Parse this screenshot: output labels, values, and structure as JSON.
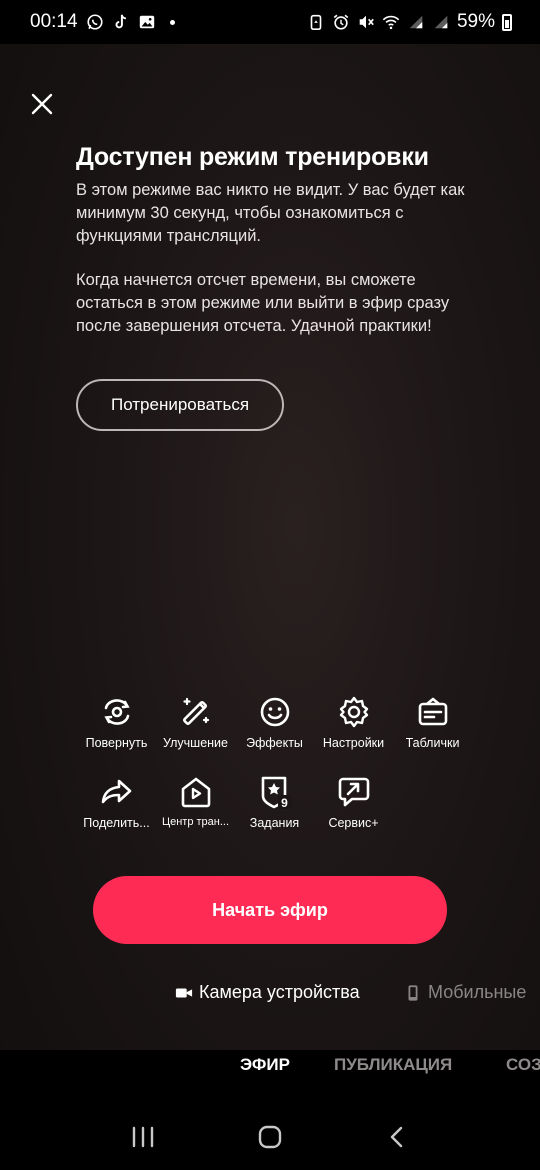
{
  "status_bar": {
    "time": "00:14",
    "battery": "59%",
    "left_icons": [
      "whatsapp-icon",
      "tiktok-icon",
      "gallery-icon"
    ],
    "right_icons": [
      "battery-saver-icon",
      "alarm-icon",
      "mute-icon",
      "wifi-icon",
      "signal-icon",
      "signal-icon"
    ]
  },
  "dialog": {
    "title": "Доступен режим тренировки",
    "paragraph1": "В этом режиме вас никто не видит. У вас будет как минимум 30 секунд, чтобы ознакомиться с функциями трансляций.",
    "paragraph2": "Когда начнется отсчет времени, вы сможете остаться в этом режиме или выйти в эфир сразу после завершения отсчета. Удачной практики!",
    "practice_button": "Потренироваться"
  },
  "tools": {
    "row1": [
      {
        "label": "Повернуть",
        "icon": "flip-camera-icon"
      },
      {
        "label": "Улучшение",
        "icon": "magic-wand-icon"
      },
      {
        "label": "Эффекты",
        "icon": "smiley-icon"
      },
      {
        "label": "Настройки",
        "icon": "gear-icon"
      },
      {
        "label": "Таблички",
        "icon": "sign-icon"
      }
    ],
    "row2": [
      {
        "label": "Поделить...",
        "icon": "share-icon"
      },
      {
        "label": "Центр тран...",
        "icon": "live-center-icon"
      },
      {
        "label": "Задания",
        "icon": "tasks-badge-icon",
        "badge": "9"
      },
      {
        "label": "Сервис+",
        "icon": "service-plus-icon"
      }
    ]
  },
  "go_live_button": "Начать эфир",
  "sources": {
    "camera": "Камера устройства",
    "mobile": "Мобильные"
  },
  "modes": [
    "ЭФИР",
    "ПУБЛИКАЦИЯ",
    "СОЗ"
  ],
  "colors": {
    "accent": "#fe2c55",
    "inactive_text": "#8f8b8b"
  }
}
